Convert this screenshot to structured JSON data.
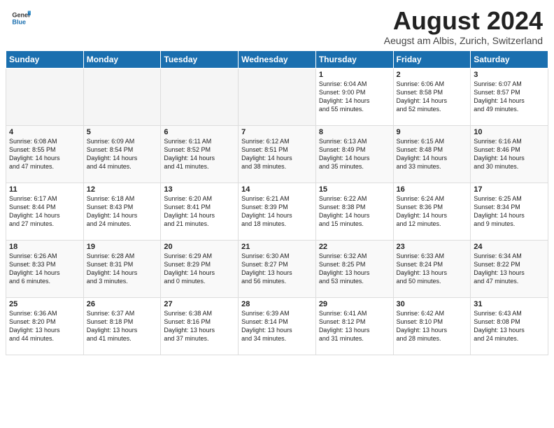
{
  "header": {
    "logo_general": "General",
    "logo_blue": "Blue",
    "month_title": "August 2024",
    "subtitle": "Aeugst am Albis, Zurich, Switzerland"
  },
  "calendar": {
    "days_of_week": [
      "Sunday",
      "Monday",
      "Tuesday",
      "Wednesday",
      "Thursday",
      "Friday",
      "Saturday"
    ],
    "weeks": [
      {
        "days": [
          {
            "num": "",
            "info": ""
          },
          {
            "num": "",
            "info": ""
          },
          {
            "num": "",
            "info": ""
          },
          {
            "num": "",
            "info": ""
          },
          {
            "num": "1",
            "info": "Sunrise: 6:04 AM\nSunset: 9:00 PM\nDaylight: 14 hours\nand 55 minutes."
          },
          {
            "num": "2",
            "info": "Sunrise: 6:06 AM\nSunset: 8:58 PM\nDaylight: 14 hours\nand 52 minutes."
          },
          {
            "num": "3",
            "info": "Sunrise: 6:07 AM\nSunset: 8:57 PM\nDaylight: 14 hours\nand 49 minutes."
          }
        ]
      },
      {
        "days": [
          {
            "num": "4",
            "info": "Sunrise: 6:08 AM\nSunset: 8:55 PM\nDaylight: 14 hours\nand 47 minutes."
          },
          {
            "num": "5",
            "info": "Sunrise: 6:09 AM\nSunset: 8:54 PM\nDaylight: 14 hours\nand 44 minutes."
          },
          {
            "num": "6",
            "info": "Sunrise: 6:11 AM\nSunset: 8:52 PM\nDaylight: 14 hours\nand 41 minutes."
          },
          {
            "num": "7",
            "info": "Sunrise: 6:12 AM\nSunset: 8:51 PM\nDaylight: 14 hours\nand 38 minutes."
          },
          {
            "num": "8",
            "info": "Sunrise: 6:13 AM\nSunset: 8:49 PM\nDaylight: 14 hours\nand 35 minutes."
          },
          {
            "num": "9",
            "info": "Sunrise: 6:15 AM\nSunset: 8:48 PM\nDaylight: 14 hours\nand 33 minutes."
          },
          {
            "num": "10",
            "info": "Sunrise: 6:16 AM\nSunset: 8:46 PM\nDaylight: 14 hours\nand 30 minutes."
          }
        ]
      },
      {
        "days": [
          {
            "num": "11",
            "info": "Sunrise: 6:17 AM\nSunset: 8:44 PM\nDaylight: 14 hours\nand 27 minutes."
          },
          {
            "num": "12",
            "info": "Sunrise: 6:18 AM\nSunset: 8:43 PM\nDaylight: 14 hours\nand 24 minutes."
          },
          {
            "num": "13",
            "info": "Sunrise: 6:20 AM\nSunset: 8:41 PM\nDaylight: 14 hours\nand 21 minutes."
          },
          {
            "num": "14",
            "info": "Sunrise: 6:21 AM\nSunset: 8:39 PM\nDaylight: 14 hours\nand 18 minutes."
          },
          {
            "num": "15",
            "info": "Sunrise: 6:22 AM\nSunset: 8:38 PM\nDaylight: 14 hours\nand 15 minutes."
          },
          {
            "num": "16",
            "info": "Sunrise: 6:24 AM\nSunset: 8:36 PM\nDaylight: 14 hours\nand 12 minutes."
          },
          {
            "num": "17",
            "info": "Sunrise: 6:25 AM\nSunset: 8:34 PM\nDaylight: 14 hours\nand 9 minutes."
          }
        ]
      },
      {
        "days": [
          {
            "num": "18",
            "info": "Sunrise: 6:26 AM\nSunset: 8:33 PM\nDaylight: 14 hours\nand 6 minutes."
          },
          {
            "num": "19",
            "info": "Sunrise: 6:28 AM\nSunset: 8:31 PM\nDaylight: 14 hours\nand 3 minutes."
          },
          {
            "num": "20",
            "info": "Sunrise: 6:29 AM\nSunset: 8:29 PM\nDaylight: 14 hours\nand 0 minutes."
          },
          {
            "num": "21",
            "info": "Sunrise: 6:30 AM\nSunset: 8:27 PM\nDaylight: 13 hours\nand 56 minutes."
          },
          {
            "num": "22",
            "info": "Sunrise: 6:32 AM\nSunset: 8:25 PM\nDaylight: 13 hours\nand 53 minutes."
          },
          {
            "num": "23",
            "info": "Sunrise: 6:33 AM\nSunset: 8:24 PM\nDaylight: 13 hours\nand 50 minutes."
          },
          {
            "num": "24",
            "info": "Sunrise: 6:34 AM\nSunset: 8:22 PM\nDaylight: 13 hours\nand 47 minutes."
          }
        ]
      },
      {
        "days": [
          {
            "num": "25",
            "info": "Sunrise: 6:36 AM\nSunset: 8:20 PM\nDaylight: 13 hours\nand 44 minutes."
          },
          {
            "num": "26",
            "info": "Sunrise: 6:37 AM\nSunset: 8:18 PM\nDaylight: 13 hours\nand 41 minutes."
          },
          {
            "num": "27",
            "info": "Sunrise: 6:38 AM\nSunset: 8:16 PM\nDaylight: 13 hours\nand 37 minutes."
          },
          {
            "num": "28",
            "info": "Sunrise: 6:39 AM\nSunset: 8:14 PM\nDaylight: 13 hours\nand 34 minutes."
          },
          {
            "num": "29",
            "info": "Sunrise: 6:41 AM\nSunset: 8:12 PM\nDaylight: 13 hours\nand 31 minutes."
          },
          {
            "num": "30",
            "info": "Sunrise: 6:42 AM\nSunset: 8:10 PM\nDaylight: 13 hours\nand 28 minutes."
          },
          {
            "num": "31",
            "info": "Sunrise: 6:43 AM\nSunset: 8:08 PM\nDaylight: 13 hours\nand 24 minutes."
          }
        ]
      }
    ]
  }
}
